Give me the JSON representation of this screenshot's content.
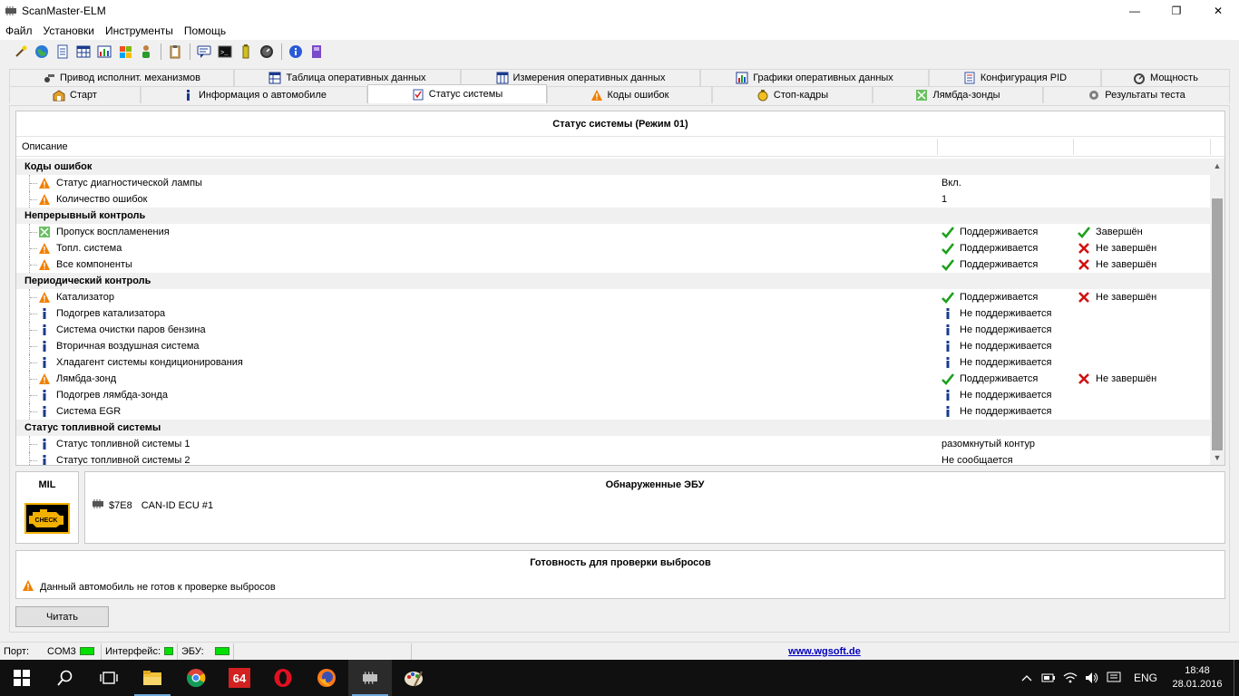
{
  "window": {
    "title": "ScanMaster-ELM",
    "minimize": "—",
    "maximize": "❐",
    "close": "✕"
  },
  "menu": [
    "Файл",
    "Установки",
    "Инструменты",
    "Помощь"
  ],
  "toolbar": {
    "icons": [
      "wizard-icon",
      "globe-icon",
      "document-icon",
      "table-icon",
      "chart-icon",
      "windows-icon",
      "person-icon",
      "clipboard-icon",
      "chat-icon",
      "terminal-icon",
      "battery-icon",
      "gauge-icon",
      "info-icon",
      "book-icon"
    ]
  },
  "tabs": {
    "row1": [
      {
        "label": "Привод исполнит. механизмов",
        "icon": "actuator-icon"
      },
      {
        "label": "Таблица оперативных данных",
        "icon": "table-icon"
      },
      {
        "label": "Измерения оперативных данных",
        "icon": "grid-icon"
      },
      {
        "label": "Графики оперативных данных",
        "icon": "chart-icon"
      },
      {
        "label": "Конфигурация PID",
        "icon": "document-icon"
      },
      {
        "label": "Мощность",
        "icon": "power-icon"
      }
    ],
    "row2": [
      {
        "label": "Старт",
        "icon": "start-icon"
      },
      {
        "label": "Информация о автомобиле",
        "icon": "info-icon"
      },
      {
        "label": "Статус системы",
        "icon": "status-icon",
        "active": true
      },
      {
        "label": "Коды ошибок",
        "icon": "warning-icon"
      },
      {
        "label": "Стоп-кадры",
        "icon": "freeze-frame-icon"
      },
      {
        "label": "Лямбда-зонды",
        "icon": "lambda-icon"
      },
      {
        "label": "Результаты теста",
        "icon": "gear-icon"
      }
    ]
  },
  "status_grid": {
    "title": "Статус системы (Режим 01)",
    "column_description": "Описание",
    "groups": [
      {
        "name": "Коды ошибок",
        "rows": [
          {
            "icon": "warning",
            "label": "Статус диагностической лампы",
            "value1": "Вкл.",
            "icon1": "",
            "value2": "",
            "icon2": ""
          },
          {
            "icon": "warning",
            "label": "Количество ошибок",
            "value1": "1",
            "icon1": "",
            "value2": "",
            "icon2": ""
          }
        ]
      },
      {
        "name": "Непрерывный контроль",
        "rows": [
          {
            "icon": "ok-green",
            "label": "Пропуск воспламенения",
            "value1": "Поддерживается",
            "icon1": "check",
            "value2": "Завершён",
            "icon2": "check"
          },
          {
            "icon": "warning",
            "label": "Топл. система",
            "value1": "Поддерживается",
            "icon1": "check",
            "value2": "Не завершён",
            "icon2": "cross"
          },
          {
            "icon": "warning",
            "label": "Все компоненты",
            "value1": "Поддерживается",
            "icon1": "check",
            "value2": "Не завершён",
            "icon2": "cross"
          }
        ]
      },
      {
        "name": "Периодический контроль",
        "rows": [
          {
            "icon": "warning",
            "label": "Катализатор",
            "value1": "Поддерживается",
            "icon1": "check",
            "value2": "Не завершён",
            "icon2": "cross"
          },
          {
            "icon": "info",
            "label": "Подогрев катализатора",
            "value1": "Не поддерживается",
            "icon1": "info",
            "value2": "",
            "icon2": ""
          },
          {
            "icon": "info",
            "label": "Система очистки паров бензина",
            "value1": "Не поддерживается",
            "icon1": "info",
            "value2": "",
            "icon2": ""
          },
          {
            "icon": "info",
            "label": "Вторичная воздушная система",
            "value1": "Не поддерживается",
            "icon1": "info",
            "value2": "",
            "icon2": ""
          },
          {
            "icon": "info",
            "label": "Хладагент системы кондиционирования",
            "value1": "Не поддерживается",
            "icon1": "info",
            "value2": "",
            "icon2": ""
          },
          {
            "icon": "warning",
            "label": "Лямбда-зонд",
            "value1": "Поддерживается",
            "icon1": "check",
            "value2": "Не завершён",
            "icon2": "cross"
          },
          {
            "icon": "info",
            "label": "Подогрев лямбда-зонда",
            "value1": "Не поддерживается",
            "icon1": "info",
            "value2": "",
            "icon2": ""
          },
          {
            "icon": "info",
            "label": "Система EGR",
            "value1": "Не поддерживается",
            "icon1": "info",
            "value2": "",
            "icon2": ""
          }
        ]
      },
      {
        "name": "Статус топливной системы",
        "rows": [
          {
            "icon": "info",
            "label": "Статус топливной системы 1",
            "value1": "разомкнутый контур",
            "icon1": "",
            "value2": "",
            "icon2": ""
          },
          {
            "icon": "info",
            "label": "Статус топливной системы 2",
            "value1": "Не сообщается",
            "icon1": "",
            "value2": "",
            "icon2": ""
          }
        ]
      }
    ]
  },
  "mil": {
    "title": "MIL",
    "lamp_text": "CHECK"
  },
  "ecu": {
    "title": "Обнаруженные ЭБУ",
    "items": [
      {
        "id": "$7E8",
        "name": "CAN-ID ECU #1"
      }
    ]
  },
  "readiness": {
    "title": "Готовность для проверки выбросов",
    "message": "Данный автомобиль не готов к проверке выбросов"
  },
  "read_button": "Читать",
  "statusbar": {
    "port_label": "Порт:",
    "port_value": "COM3",
    "interface_label": "Интерфейс:",
    "ecu_label": "ЭБУ:",
    "url": "www.wgsoft.de"
  },
  "taskbar": {
    "apps": [
      "windows-start-icon",
      "search-icon",
      "task-view-icon",
      "file-explorer-icon",
      "chrome-icon",
      "aida64-icon",
      "opera-icon",
      "firefox-icon",
      "scanmaster-icon",
      "paint-icon"
    ],
    "app_text_64": "64",
    "language": "ENG",
    "time": "18:48",
    "date": "28.01.2016"
  },
  "colors": {
    "led_green": "#00e000",
    "check_green": "#1ea01e",
    "cross_red": "#d01010",
    "warning_orange": "#f08000",
    "info_blue": "#1a3a8c",
    "link_blue": "#0000c0"
  }
}
